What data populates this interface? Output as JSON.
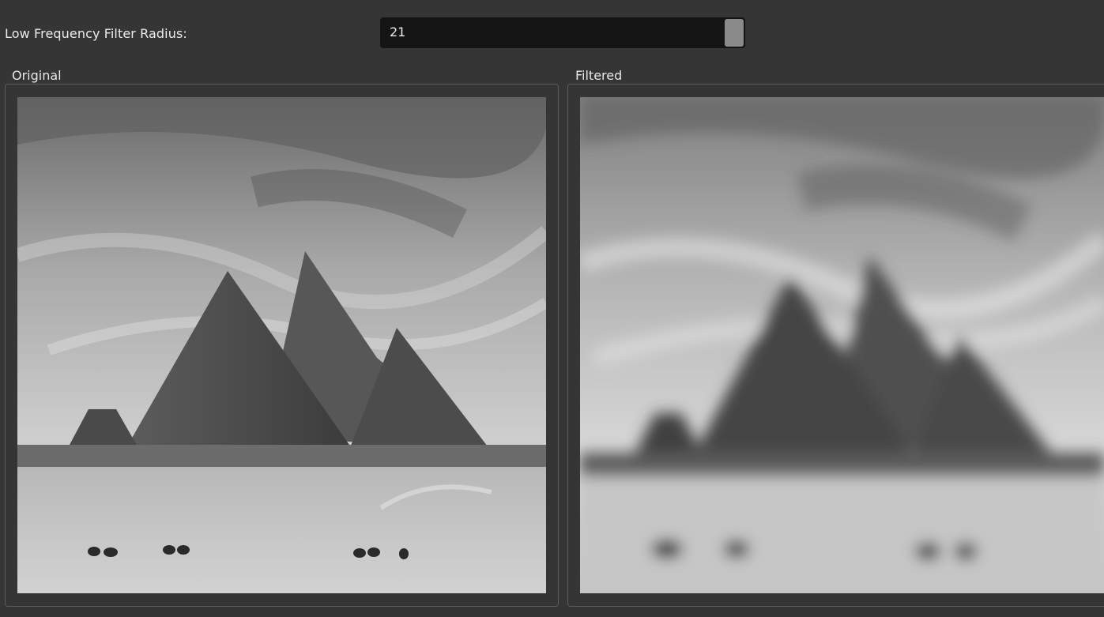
{
  "controls": {
    "filter_radius_label": "Low Frequency Filter Radius:",
    "filter_radius_value": "21"
  },
  "panels": {
    "original": {
      "title": "Original"
    },
    "filtered": {
      "title": "Filtered"
    }
  },
  "colors": {
    "window_bg": "#353535",
    "input_bg": "#141414",
    "group_border": "#5c5c5c",
    "slider_handle": "#8a8a8a"
  },
  "icons": [
    "spinbox-handle"
  ]
}
